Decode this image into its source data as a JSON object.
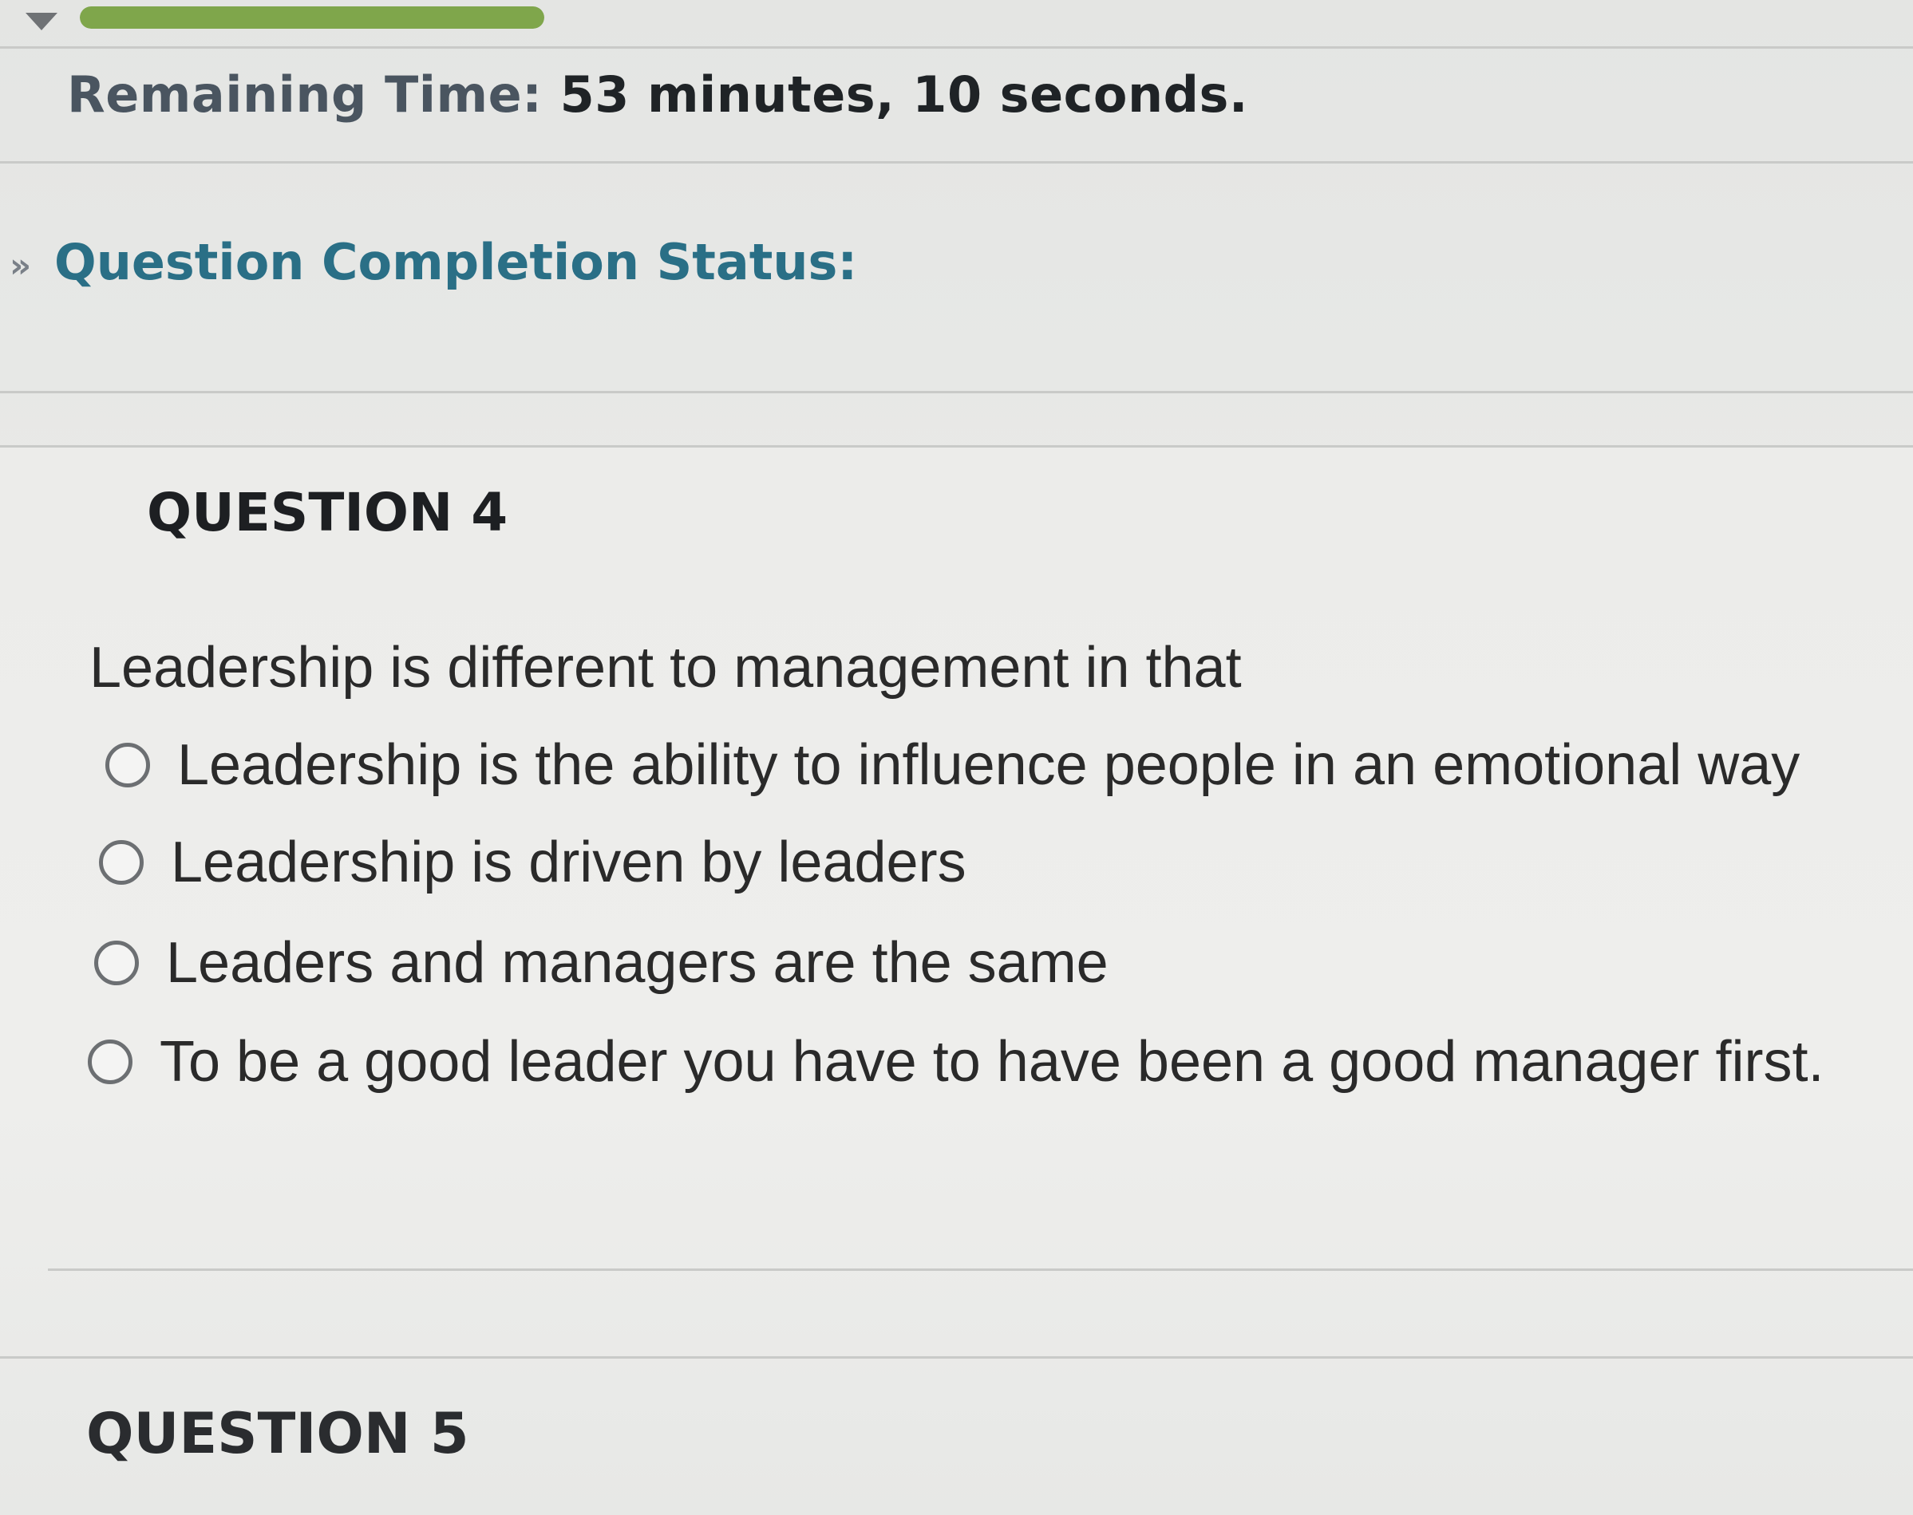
{
  "progress": {
    "fill_percent": 100,
    "color": "#7fa64b"
  },
  "timer": {
    "label": "Remaining Time:",
    "value": "53 minutes, 10 seconds."
  },
  "completion_status": {
    "toggle_icon": "double-chevron-down-icon",
    "toggle_glyph": "»",
    "heading": "Question Completion Status:",
    "heading_color": "#2a6f86"
  },
  "question": {
    "title": "QUESTION 4",
    "text": "Leadership is different to management in that",
    "options": [
      {
        "label": "Leadership is the ability to influence people in an emotional way",
        "selected": false
      },
      {
        "label": "Leadership is driven by leaders",
        "selected": false
      },
      {
        "label": "Leaders and managers are the same",
        "selected": false
      },
      {
        "label": "To be a good leader you have to have been a good manager first.",
        "selected": false
      }
    ]
  },
  "next_question": {
    "title": "QUESTION 5"
  }
}
